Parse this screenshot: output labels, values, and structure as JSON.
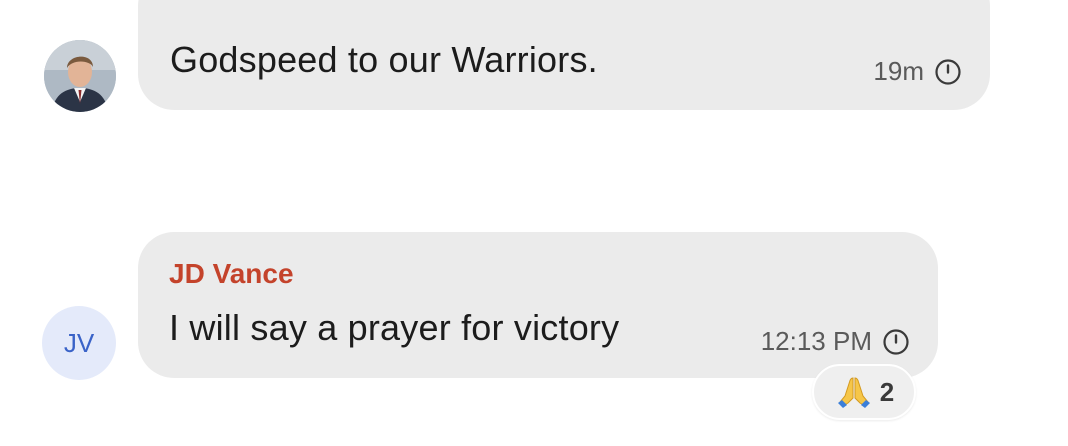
{
  "messages": [
    {
      "sender": "",
      "avatar": "profile-photo",
      "text": "Godspeed to our Warriors.",
      "time": "19m",
      "status_icon": "clock-icon"
    },
    {
      "sender": "JD Vance",
      "avatar_initials": "JV",
      "text": "I will say a prayer for victory",
      "time": "12:13 PM",
      "status_icon": "clock-icon",
      "reaction": {
        "emoji": "praying-hands-icon",
        "count": "2"
      }
    }
  ],
  "colors": {
    "bubble": "#ebebeb",
    "sender_name": "#c4432b",
    "initials_bg": "#e4eafa",
    "initials_text": "#3a63c8"
  }
}
